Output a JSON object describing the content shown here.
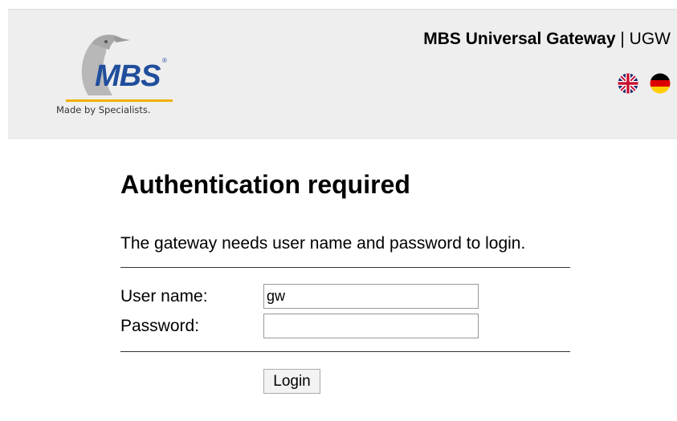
{
  "header": {
    "logo": {
      "brand": "MBS",
      "registered": "®",
      "tagline": "Made by Specialists.",
      "icon": "penguin-logo-icon"
    },
    "product_name": "MBS Universal Gateway",
    "separator": "|",
    "product_short": "UGW",
    "flags": [
      {
        "icon": "uk-flag-icon"
      },
      {
        "icon": "german-flag-icon"
      }
    ]
  },
  "main": {
    "title": "Authentication required",
    "description": "The gateway needs user name and password to login.",
    "username_label": "User name:",
    "username_value": "gw",
    "password_label": "Password:",
    "password_value": "",
    "login_label": "Login"
  },
  "colors": {
    "brand_blue": "#1f4e9c",
    "brand_yellow": "#f2b000",
    "header_bg": "#eeeeee"
  }
}
